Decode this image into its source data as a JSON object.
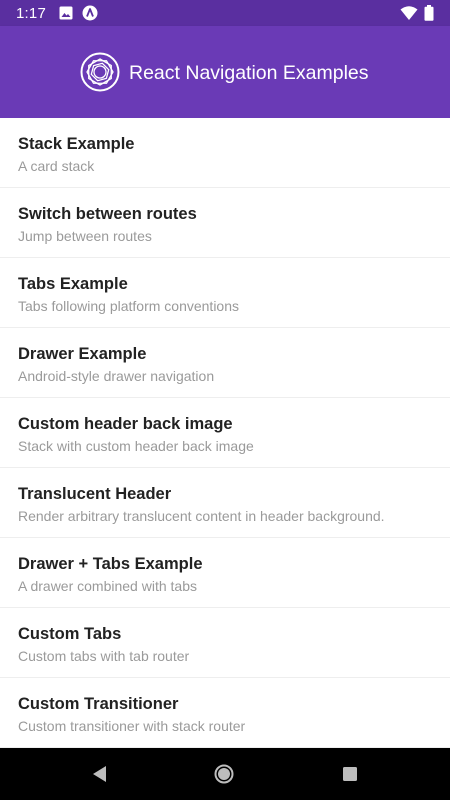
{
  "status_bar": {
    "time": "1:17",
    "background": "#5a2fa0",
    "icons": [
      "image-icon",
      "react-native-icon",
      "wifi-icon",
      "battery-icon"
    ]
  },
  "header": {
    "title": "React Navigation Examples",
    "logo_icon": "react-navigation-logo-icon",
    "background": "#6a3ab6"
  },
  "examples": [
    {
      "title": "Stack Example",
      "subtitle": "A card stack"
    },
    {
      "title": "Switch between routes",
      "subtitle": "Jump between routes"
    },
    {
      "title": "Tabs Example",
      "subtitle": "Tabs following platform conventions"
    },
    {
      "title": "Drawer Example",
      "subtitle": "Android-style drawer navigation"
    },
    {
      "title": "Custom header back image",
      "subtitle": "Stack with custom header back image"
    },
    {
      "title": "Translucent Header",
      "subtitle": "Render arbitrary translucent content in header background."
    },
    {
      "title": "Drawer + Tabs Example",
      "subtitle": "A drawer combined with tabs"
    },
    {
      "title": "Custom Tabs",
      "subtitle": "Custom tabs with tab router"
    },
    {
      "title": "Custom Transitioner",
      "subtitle": "Custom transitioner with stack router"
    }
  ],
  "nav_bar": {
    "icons": [
      "back-icon",
      "home-icon",
      "recents-icon"
    ]
  }
}
